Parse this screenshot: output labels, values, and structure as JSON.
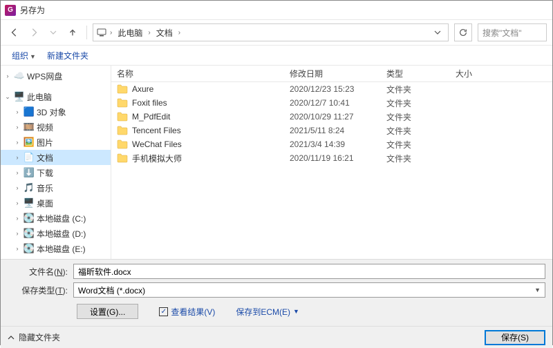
{
  "window": {
    "title": "另存为"
  },
  "path": {
    "segments": [
      "此电脑",
      "文档"
    ]
  },
  "search": {
    "placeholder": "搜索\"文档\""
  },
  "toolbar": {
    "organize": "组织",
    "new_folder": "新建文件夹"
  },
  "sidebar": {
    "wps": "WPS网盘",
    "this_pc": "此电脑",
    "items": [
      {
        "label": "3D 对象"
      },
      {
        "label": "视频"
      },
      {
        "label": "图片"
      },
      {
        "label": "文档"
      },
      {
        "label": "下载"
      },
      {
        "label": "音乐"
      },
      {
        "label": "桌面"
      },
      {
        "label": "本地磁盘 (C:)"
      },
      {
        "label": "本地磁盘 (D:)"
      },
      {
        "label": "本地磁盘 (E:)"
      }
    ]
  },
  "columns": {
    "name": "名称",
    "date": "修改日期",
    "type": "类型",
    "size": "大小"
  },
  "rows": [
    {
      "name": "Axure",
      "date": "2020/12/23 15:23",
      "type": "文件夹"
    },
    {
      "name": "Foxit files",
      "date": "2020/12/7 10:41",
      "type": "文件夹"
    },
    {
      "name": "M_PdfEdit",
      "date": "2020/10/29 11:27",
      "type": "文件夹"
    },
    {
      "name": "Tencent Files",
      "date": "2021/5/11 8:24",
      "type": "文件夹"
    },
    {
      "name": "WeChat Files",
      "date": "2021/3/4 14:39",
      "type": "文件夹"
    },
    {
      "name": "手机模拟大师",
      "date": "2020/11/19 16:21",
      "type": "文件夹"
    }
  ],
  "form": {
    "filename_label_pre": "文件名(",
    "filename_label_u": "N",
    "filename_label_post": "):",
    "filename_value": "福昕软件.docx",
    "filetype_label_pre": "保存类型(",
    "filetype_label_u": "T",
    "filetype_label_post": "):",
    "filetype_value": "Word文档 (*.docx)",
    "settings": "设置(G)...",
    "view_result": "查看结果(V)",
    "save_ecm": "保存到ECM(E)",
    "hide_folders": "隐藏文件夹",
    "save": "保存(S)"
  }
}
